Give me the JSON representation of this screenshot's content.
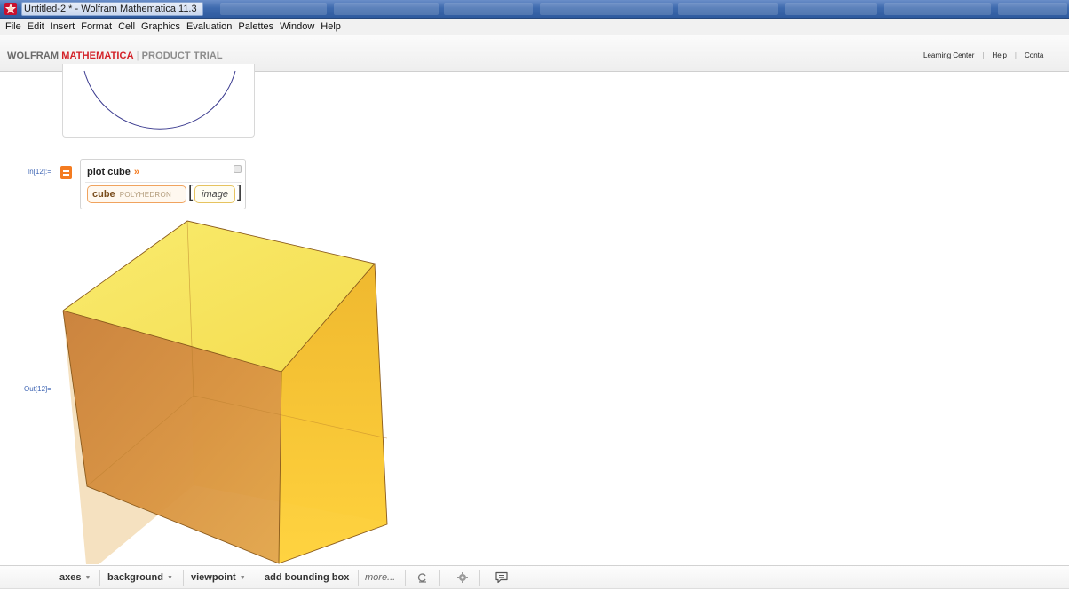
{
  "window": {
    "title": "Untitled-2 * - Wolfram Mathematica 11.3"
  },
  "menu": [
    "File",
    "Edit",
    "Insert",
    "Format",
    "Cell",
    "Graphics",
    "Evaluation",
    "Palettes",
    "Window",
    "Help"
  ],
  "banner": {
    "wolfram": "WOLFRAM",
    "mathematica": "MATHEMATICA",
    "separator": "|",
    "trial": "PRODUCT TRIAL",
    "links": [
      "Learning Center",
      "Help",
      "Conta"
    ]
  },
  "notebook": {
    "in_label": "In[12]:=",
    "out_label": "Out[12]=",
    "query": "plot cube",
    "query_chevron": "»",
    "interpretation": {
      "entity": "cube",
      "entity_type": "POLYHEDRON",
      "open_bracket": "[",
      "property": "image",
      "close_bracket": "]"
    }
  },
  "suggestions": {
    "buttons": [
      "axes",
      "background",
      "viewpoint",
      "add bounding box"
    ],
    "dropdown_flags": [
      true,
      true,
      true,
      false
    ],
    "caret": "▼",
    "more": "more..."
  },
  "colors": {
    "accent_orange": "#f47b20",
    "brand_red": "#d32128",
    "title_bar": "#3e6aae",
    "link_blue": "#3d64b3",
    "cube_top": "#f7e65a",
    "cube_front": "#d48a3c",
    "cube_right": "#f2c233"
  },
  "icons": {
    "app": "mathematica-spikey-icon",
    "input_mode": "wolfram-alpha-input-icon",
    "collapse": "collapse-square-icon",
    "undo": "rotate-undo-icon",
    "settings": "gear-icon",
    "feedback": "speech-bubble-icon"
  }
}
